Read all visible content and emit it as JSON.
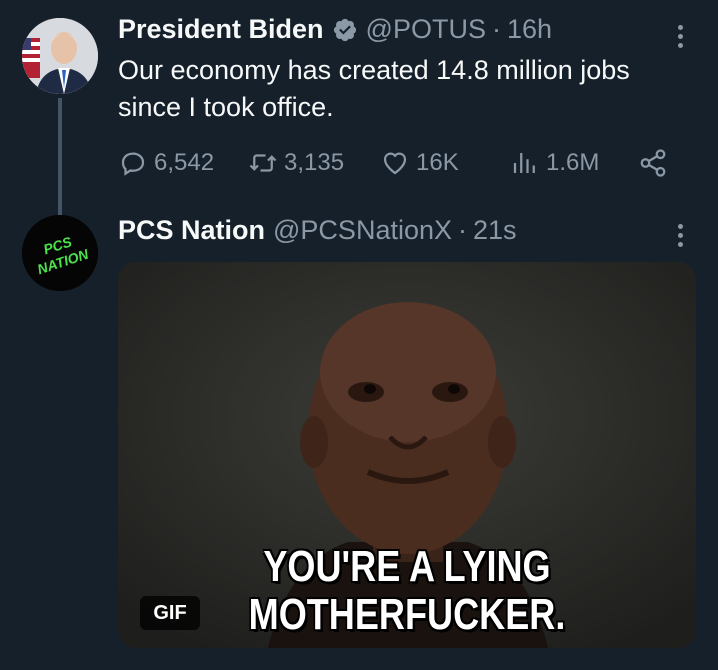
{
  "tweet1": {
    "name": "President Biden",
    "handle": "@POTUS",
    "separator": "·",
    "time": "16h",
    "text": "Our economy has created 14.8 million jobs since I took office.",
    "replies": "6,542",
    "retweets": "3,135",
    "likes": "16K",
    "views": "1.6M"
  },
  "tweet2": {
    "name": "PCS Nation",
    "handle": "@PCSNationX",
    "separator": "·",
    "time": "21s",
    "avatar_text": [
      "PCS",
      "NATION"
    ],
    "media": {
      "badge": "GIF",
      "caption_line1": "YOU'RE A LYING",
      "caption_line2": "MOTHERFUCKER."
    }
  },
  "colors": {
    "background": "#15202b",
    "text_primary": "#f7f9f9",
    "text_secondary": "#8b98a5",
    "verified_badge": "#8b98a5",
    "pcs_avatar_text": "#4be34b"
  },
  "icons": [
    "more-icon",
    "verified-icon",
    "reply-icon",
    "retweet-icon",
    "like-icon",
    "views-icon",
    "share-icon"
  ]
}
